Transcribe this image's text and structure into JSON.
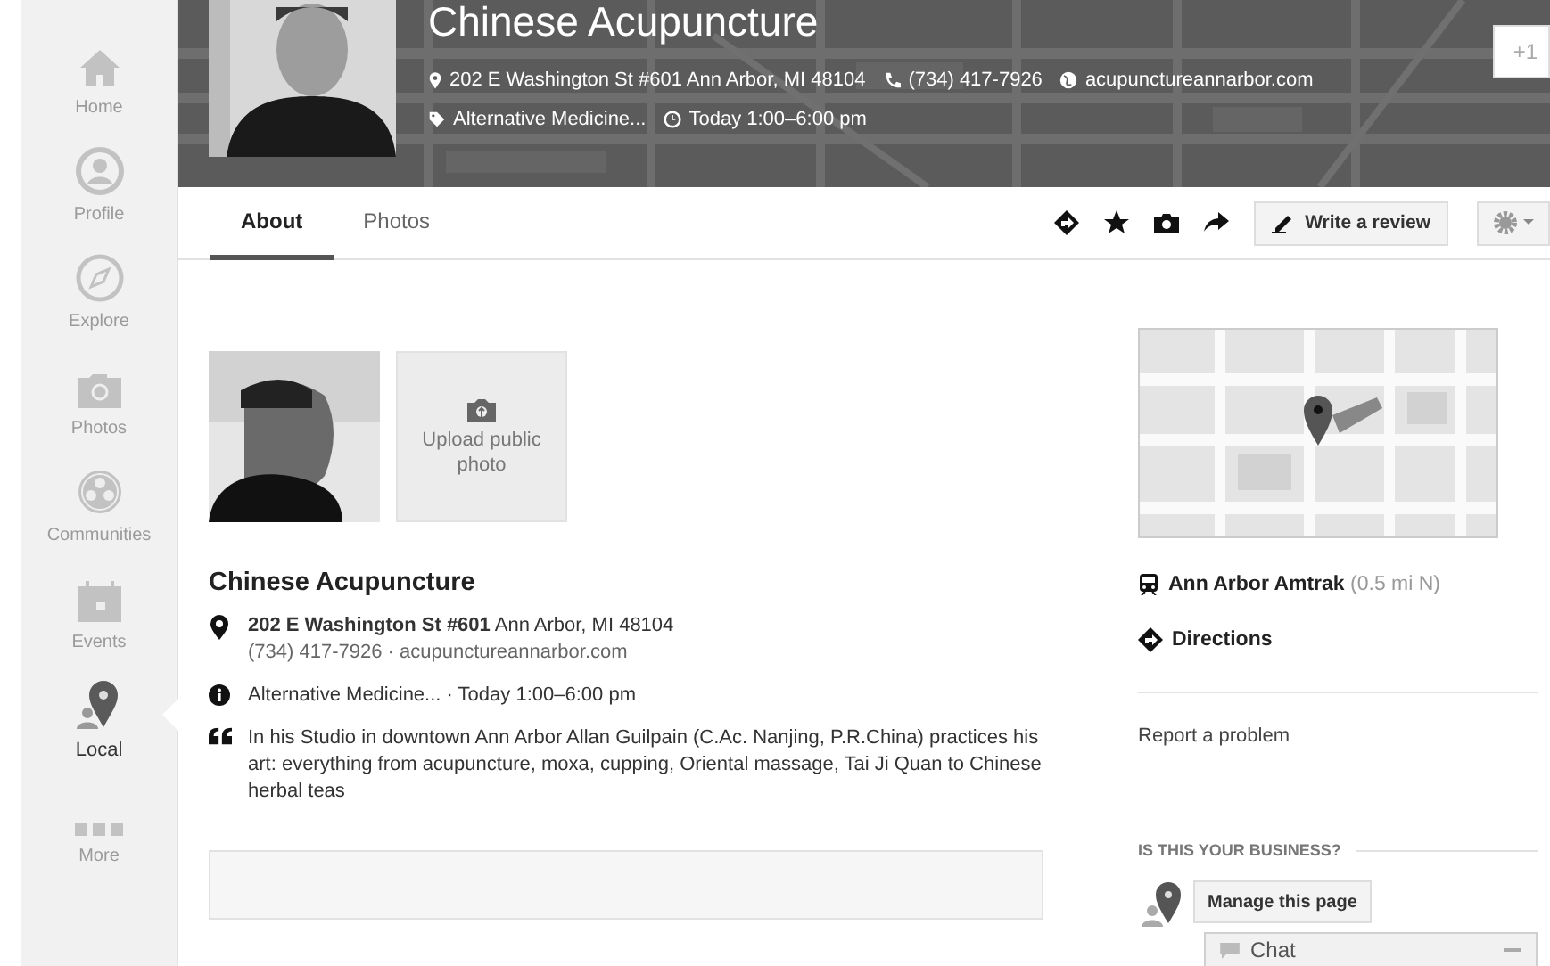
{
  "sidebar": {
    "items": [
      {
        "label": "Home",
        "kind": "home",
        "selected": false
      },
      {
        "label": "Profile",
        "kind": "profile",
        "selected": false
      },
      {
        "label": "Explore",
        "kind": "explore",
        "selected": false
      },
      {
        "label": "Photos",
        "kind": "photos",
        "selected": false
      },
      {
        "label": "Communities",
        "kind": "communities",
        "selected": false
      },
      {
        "label": "Events",
        "kind": "events",
        "selected": false
      },
      {
        "label": "Local",
        "kind": "local",
        "selected": true
      },
      {
        "label": "More",
        "kind": "more",
        "selected": false
      }
    ]
  },
  "header": {
    "title": "Chinese Acupuncture",
    "address": "202 E Washington St #601 Ann Arbor, MI 48104",
    "phone": "(734) 417-7926",
    "website": "acupunctureannarbor.com",
    "category": "Alternative Medicine...",
    "hours": "Today 1:00–6:00 pm",
    "plus_one": "+1"
  },
  "tabs": [
    {
      "label": "About",
      "selected": true
    },
    {
      "label": "Photos",
      "selected": false
    }
  ],
  "toolbar": {
    "review_button": "Write a review"
  },
  "photos": {
    "upload_label": "Upload public photo"
  },
  "place": {
    "name": "Chinese Acupuncture",
    "address": "**202 E Washington St #601** Ann Arbor, MI 48104",
    "contact": "(734) 417-7926 · acupunctureannarbor.com",
    "info": "Alternative Medicine... · Today 1:00–6:00 pm",
    "description": "In his Studio in downtown Ann Arbor Allan Guilpain (C.Ac. Nanjing, P.R.China) practices his art: everything from acupuncture, moxa, cupping, Oriental massage, Tai Ji Quan to Chinese herbal teas"
  },
  "side": {
    "transit": "**Ann Arbor Amtrak** (0.5 mi N)",
    "directions": "Directions",
    "report": "Report a problem",
    "business_heading": "IS THIS YOUR BUSINESS?",
    "manage_button": "Manage this page"
  },
  "chat": {
    "label": "Chat"
  }
}
